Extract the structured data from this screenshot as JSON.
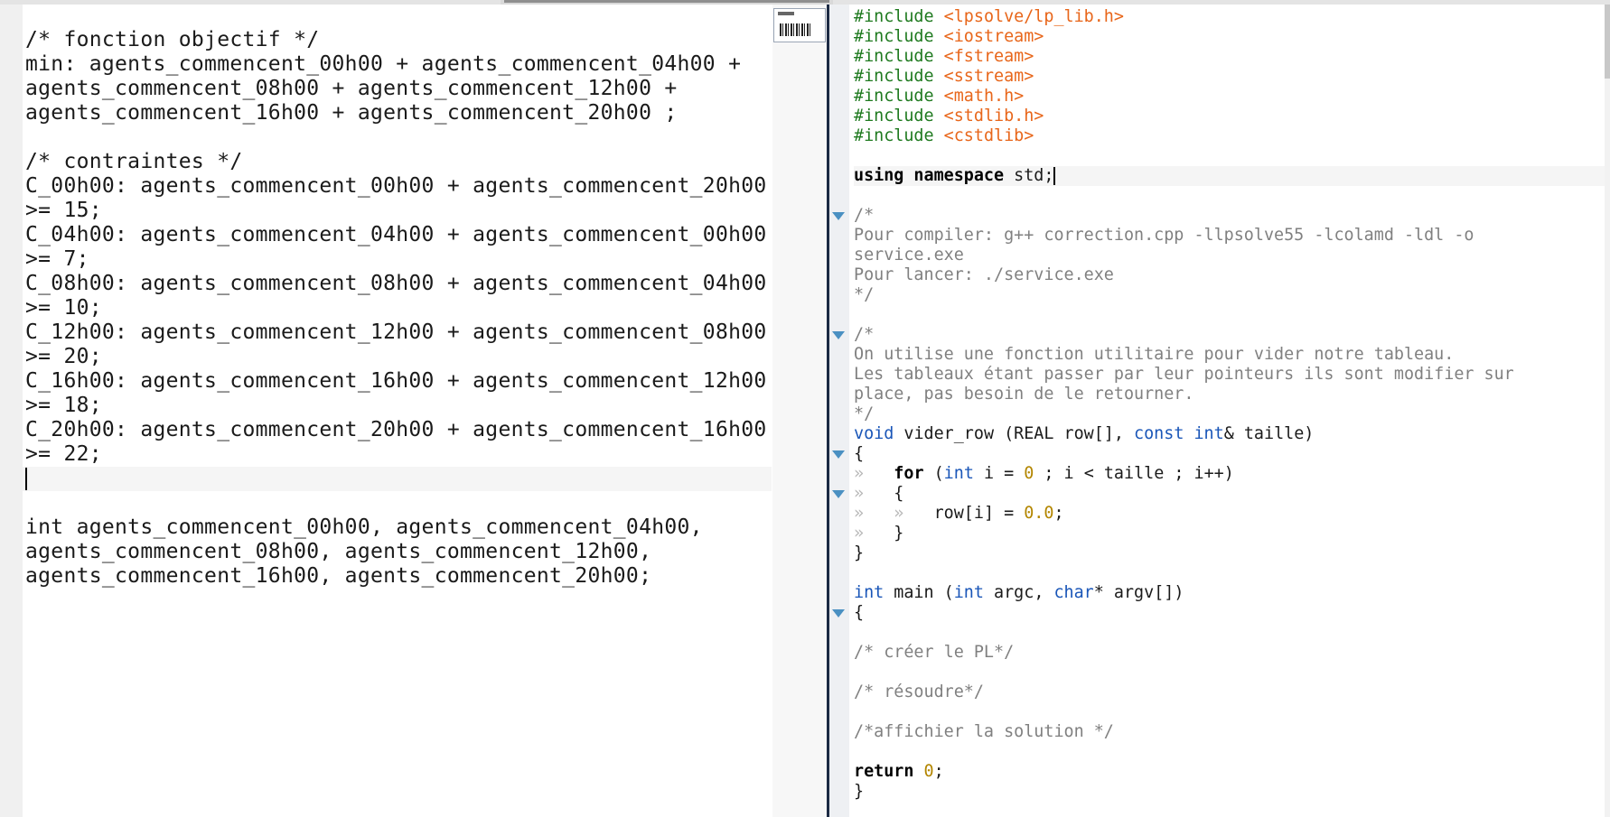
{
  "left_editor": {
    "lines": [
      "/* fonction objectif */",
      "min: agents_commencent_00h00 + agents_commencent_04h00 +",
      "agents_commencent_08h00 + agents_commencent_12h00 +",
      "agents_commencent_16h00 + agents_commencent_20h00 ;",
      "",
      "/* contraintes */",
      "C_00h00: agents_commencent_00h00 + agents_commencent_20h00",
      ">= 15;",
      "C_04h00: agents_commencent_04h00 + agents_commencent_00h00",
      ">= 7;",
      "C_08h00: agents_commencent_08h00 + agents_commencent_04h00",
      ">= 10;",
      "C_12h00: agents_commencent_12h00 + agents_commencent_08h00",
      ">= 20;",
      "C_16h00: agents_commencent_16h00 + agents_commencent_12h00",
      ">= 18;",
      "C_20h00: agents_commencent_20h00 + agents_commencent_16h00",
      ">= 22;",
      "",
      "",
      "int agents_commencent_00h00, agents_commencent_04h00,",
      "agents_commencent_08h00, agents_commencent_12h00,",
      "agents_commencent_16h00, agents_commencent_20h00;"
    ],
    "cursor_line": 19
  },
  "right_editor": {
    "lines": [
      {
        "fold": false,
        "tokens": [
          {
            "t": "#include ",
            "c": "pp"
          },
          {
            "t": "<lpsolve/lp_lib.h>",
            "c": "inc"
          }
        ]
      },
      {
        "fold": false,
        "tokens": [
          {
            "t": "#include ",
            "c": "pp"
          },
          {
            "t": "<iostream>",
            "c": "inc"
          }
        ]
      },
      {
        "fold": false,
        "tokens": [
          {
            "t": "#include ",
            "c": "pp"
          },
          {
            "t": "<fstream>",
            "c": "inc"
          }
        ]
      },
      {
        "fold": false,
        "tokens": [
          {
            "t": "#include ",
            "c": "pp"
          },
          {
            "t": "<sstream>",
            "c": "inc"
          }
        ]
      },
      {
        "fold": false,
        "tokens": [
          {
            "t": "#include ",
            "c": "pp"
          },
          {
            "t": "<math.h>",
            "c": "inc"
          }
        ]
      },
      {
        "fold": false,
        "tokens": [
          {
            "t": "#include ",
            "c": "pp"
          },
          {
            "t": "<stdlib.h>",
            "c": "inc"
          }
        ]
      },
      {
        "fold": false,
        "tokens": [
          {
            "t": "#include ",
            "c": "pp"
          },
          {
            "t": "<cstdlib>",
            "c": "inc"
          }
        ]
      },
      {
        "fold": false,
        "tokens": []
      },
      {
        "fold": false,
        "current": true,
        "cursor": true,
        "tokens": [
          {
            "t": "using namespace",
            "c": "kw"
          },
          {
            "t": " std;",
            "c": "plain"
          }
        ]
      },
      {
        "fold": false,
        "tokens": []
      },
      {
        "fold": true,
        "tokens": [
          {
            "t": "/*",
            "c": "cm"
          }
        ]
      },
      {
        "fold": false,
        "tokens": [
          {
            "t": "Pour compiler: g++ correction.cpp -llpsolve55 -lcolamd -ldl -o",
            "c": "cm"
          }
        ]
      },
      {
        "fold": false,
        "tokens": [
          {
            "t": "service.exe",
            "c": "cm"
          }
        ]
      },
      {
        "fold": false,
        "tokens": [
          {
            "t": "Pour lancer: ./service.exe",
            "c": "cm"
          }
        ]
      },
      {
        "fold": false,
        "tokens": [
          {
            "t": "*/",
            "c": "cm"
          }
        ]
      },
      {
        "fold": false,
        "tokens": []
      },
      {
        "fold": true,
        "tokens": [
          {
            "t": "/*",
            "c": "cm"
          }
        ]
      },
      {
        "fold": false,
        "tokens": [
          {
            "t": "On utilise une fonction utilitaire pour vider notre tableau.",
            "c": "cm"
          }
        ]
      },
      {
        "fold": false,
        "tokens": [
          {
            "t": "Les tableaux étant passer par leur pointeurs ils sont modifier sur",
            "c": "cm"
          }
        ]
      },
      {
        "fold": false,
        "tokens": [
          {
            "t": "place, pas besoin de le retourner.",
            "c": "cm"
          }
        ]
      },
      {
        "fold": false,
        "tokens": [
          {
            "t": "*/",
            "c": "cm"
          }
        ]
      },
      {
        "fold": false,
        "tokens": [
          {
            "t": "void",
            "c": "type"
          },
          {
            "t": " vider_row (REAL row[], ",
            "c": "plain"
          },
          {
            "t": "const",
            "c": "type"
          },
          {
            "t": " ",
            "c": "plain"
          },
          {
            "t": "int",
            "c": "type"
          },
          {
            "t": "& taille)",
            "c": "plain"
          }
        ]
      },
      {
        "fold": true,
        "tokens": [
          {
            "t": "{",
            "c": "plain"
          }
        ]
      },
      {
        "fold": false,
        "tokens": [
          {
            "t": "»   ",
            "c": "tab"
          },
          {
            "t": "for",
            "c": "kw"
          },
          {
            "t": " (",
            "c": "plain"
          },
          {
            "t": "int",
            "c": "type"
          },
          {
            "t": " i = ",
            "c": "plain"
          },
          {
            "t": "0",
            "c": "num"
          },
          {
            "t": " ; i < taille ; i++)",
            "c": "plain"
          }
        ]
      },
      {
        "fold": true,
        "tokens": [
          {
            "t": "»   ",
            "c": "tab"
          },
          {
            "t": "{",
            "c": "plain"
          }
        ]
      },
      {
        "fold": false,
        "tokens": [
          {
            "t": "»   »   ",
            "c": "tab"
          },
          {
            "t": "row[i] = ",
            "c": "plain"
          },
          {
            "t": "0.0",
            "c": "num"
          },
          {
            "t": ";",
            "c": "plain"
          }
        ]
      },
      {
        "fold": false,
        "tokens": [
          {
            "t": "»   ",
            "c": "tab"
          },
          {
            "t": "}",
            "c": "plain"
          }
        ]
      },
      {
        "fold": false,
        "tokens": [
          {
            "t": "}",
            "c": "plain"
          }
        ]
      },
      {
        "fold": false,
        "tokens": []
      },
      {
        "fold": false,
        "tokens": [
          {
            "t": "int",
            "c": "type"
          },
          {
            "t": " main (",
            "c": "plain"
          },
          {
            "t": "int",
            "c": "type"
          },
          {
            "t": " argc, ",
            "c": "plain"
          },
          {
            "t": "char",
            "c": "type"
          },
          {
            "t": "* argv[])",
            "c": "plain"
          }
        ]
      },
      {
        "fold": true,
        "tokens": [
          {
            "t": "{",
            "c": "plain"
          }
        ]
      },
      {
        "fold": false,
        "tokens": []
      },
      {
        "fold": false,
        "tokens": [
          {
            "t": "/* créer le PL*/",
            "c": "cm"
          }
        ]
      },
      {
        "fold": false,
        "tokens": []
      },
      {
        "fold": false,
        "tokens": [
          {
            "t": "/* résoudre*/",
            "c": "cm"
          }
        ]
      },
      {
        "fold": false,
        "tokens": []
      },
      {
        "fold": false,
        "tokens": [
          {
            "t": "/*affichier la solution */",
            "c": "cm"
          }
        ]
      },
      {
        "fold": false,
        "tokens": []
      },
      {
        "fold": false,
        "tokens": [
          {
            "t": "return",
            "c": "kw"
          },
          {
            "t": " ",
            "c": "plain"
          },
          {
            "t": "0",
            "c": "num"
          },
          {
            "t": ";",
            "c": "plain"
          }
        ]
      },
      {
        "fold": false,
        "tokens": [
          {
            "t": "}",
            "c": "plain"
          }
        ]
      }
    ]
  },
  "colors": {
    "preprocessor": "#1f7a1f",
    "include": "#e8661a",
    "type": "#1a56b8",
    "number": "#b38600",
    "comment": "#808080",
    "fold_marker": "#4a90c2",
    "divider": "#1c2a44"
  },
  "icons": {
    "fold": "fold-triangle-icon",
    "minimap": "minimap-thumbnail-icon"
  }
}
